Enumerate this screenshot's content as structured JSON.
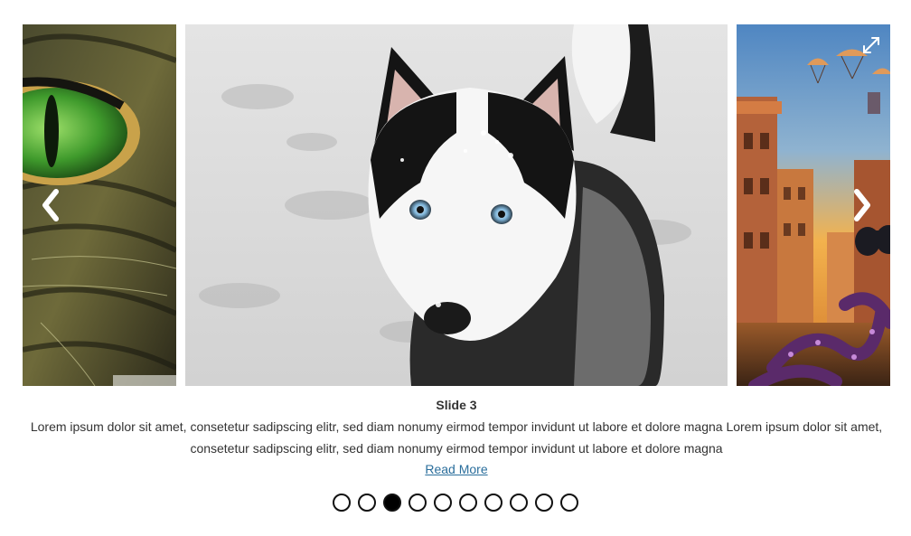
{
  "slides": [
    {
      "position": "previous",
      "subject": "cat eye close-up",
      "icon": "cat-image"
    },
    {
      "position": "current",
      "subject": "husky dog in snow",
      "icon": "husky-image"
    },
    {
      "position": "next",
      "subject": "fantasy city street with parachutes and octopus",
      "icon": "city-image"
    }
  ],
  "caption": {
    "title": "Slide 3",
    "text": "Lorem ipsum dolor sit amet, consetetur sadipscing elitr, sed diam nonumy eirmod tempor invidunt ut labore et dolore magna Lorem ipsum dolor sit amet, consetetur sadipscing elitr, sed diam nonumy eirmod tempor invidunt ut labore et dolore magna",
    "read_more": "Read More"
  },
  "controls": {
    "prev_icon": "chevron-left-icon",
    "next_icon": "chevron-right-icon",
    "fullscreen_icon": "expand-icon"
  },
  "pagination": {
    "total": 10,
    "current": 3
  },
  "colors": {
    "link": "#2a6e9c",
    "dot_border": "#111111",
    "dot_active": "#000000"
  }
}
